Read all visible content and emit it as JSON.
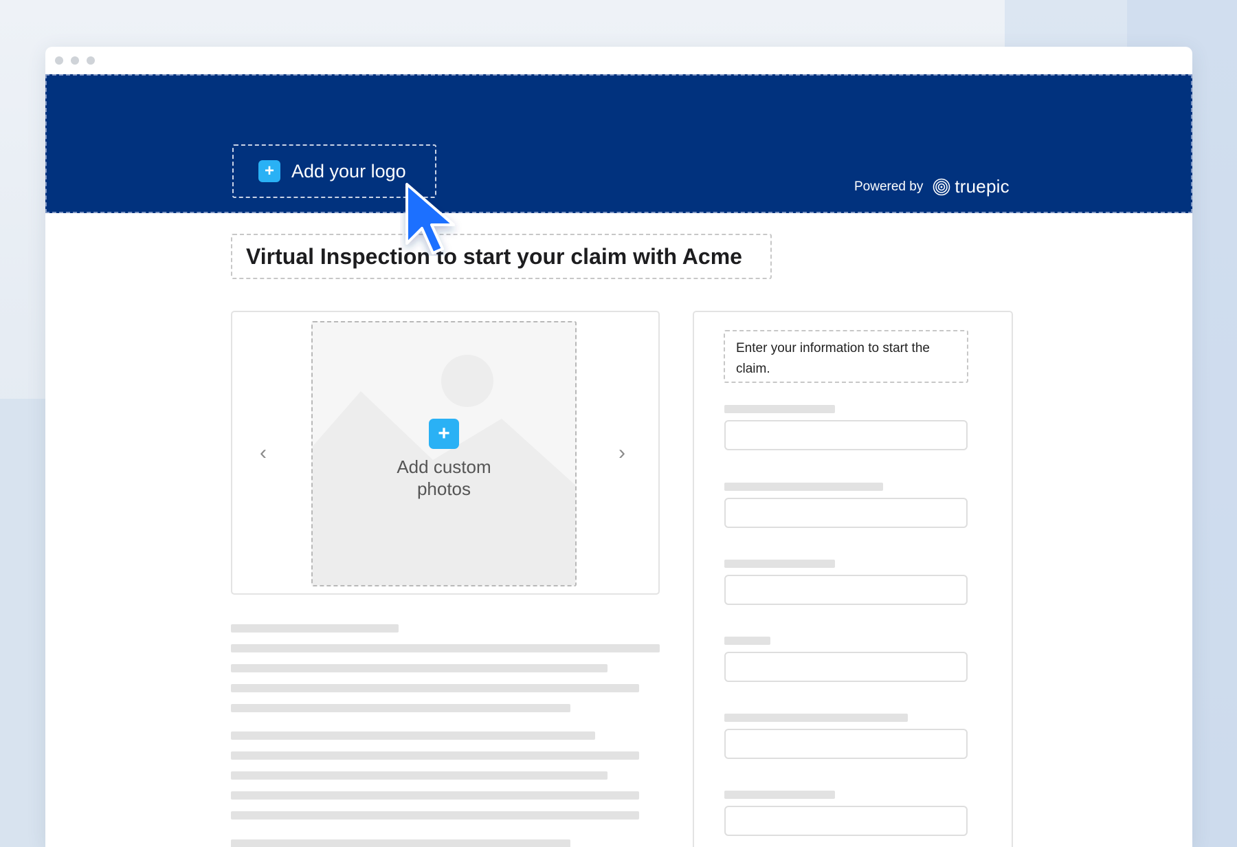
{
  "header": {
    "logo_slot_label": "Add your logo",
    "powered_by_label": "Powered by",
    "brand_name": "truepic",
    "banner_color": "#01327e"
  },
  "title": {
    "text": "Virtual Inspection to start your claim with Acme"
  },
  "gallery": {
    "photo_slot_label": "Add custom photos",
    "prev_arrow": "‹",
    "next_arrow": "›"
  },
  "form": {
    "intro_text": "Enter your information to start the claim."
  },
  "colors": {
    "accent": "#2ab1f5",
    "cursor": "#1e6fff"
  }
}
